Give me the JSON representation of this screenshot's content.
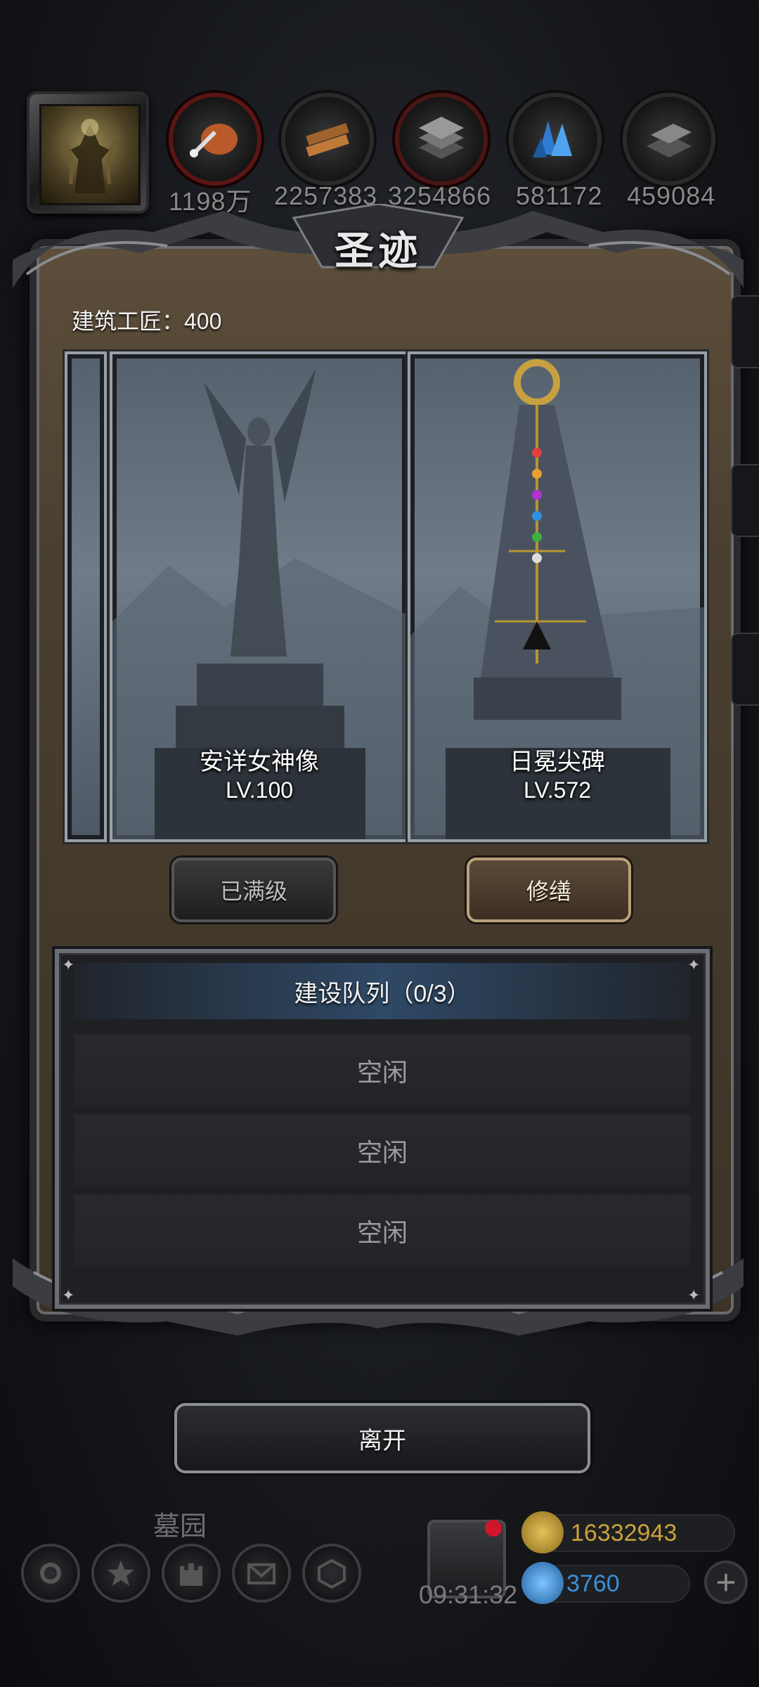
{
  "resources": [
    {
      "name": "food",
      "value": "1198万"
    },
    {
      "name": "wood",
      "value": "2257383"
    },
    {
      "name": "stone",
      "value": "3254866"
    },
    {
      "name": "crystal",
      "value": "581172"
    },
    {
      "name": "iron",
      "value": "459084"
    }
  ],
  "panel": {
    "title": "圣迹",
    "builder_label": "建筑工匠：400"
  },
  "cards": [
    {
      "name": "安详女神像",
      "level": "LV.100",
      "button": "已满级"
    },
    {
      "name": "日冕尖碑",
      "level": "LV.572",
      "button": "修缮"
    }
  ],
  "queue": {
    "title": "建设队列（0/3）",
    "slots": [
      "空闲",
      "空闲",
      "空闲"
    ]
  },
  "leave_label": "离开",
  "hud": {
    "location": "墓园",
    "timer": "09:31:32",
    "gold": "16332943",
    "gems": "3760",
    "gold_color": "#c9a23a",
    "gem_color": "#3b8fd8"
  }
}
